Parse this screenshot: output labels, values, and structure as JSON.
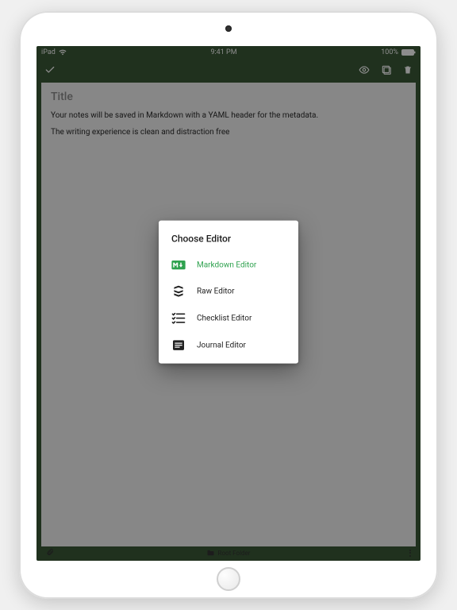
{
  "status": {
    "device": "iPad",
    "time": "9:41 PM",
    "battery": "100%"
  },
  "note": {
    "title_placeholder": "Title",
    "line1": "Your notes will be saved in Markdown with a YAML header for the metadata.",
    "line2": "The writing experience is clean and distraction free"
  },
  "footer": {
    "folder": "Root Folder"
  },
  "dialog": {
    "title": "Choose Editor",
    "options": {
      "markdown": "Markdown Editor",
      "raw": "Raw Editor",
      "checklist": "Checklist Editor",
      "journal": "Journal Editor"
    }
  },
  "colors": {
    "header": "#3b5a38",
    "accent": "#2fa24f"
  }
}
